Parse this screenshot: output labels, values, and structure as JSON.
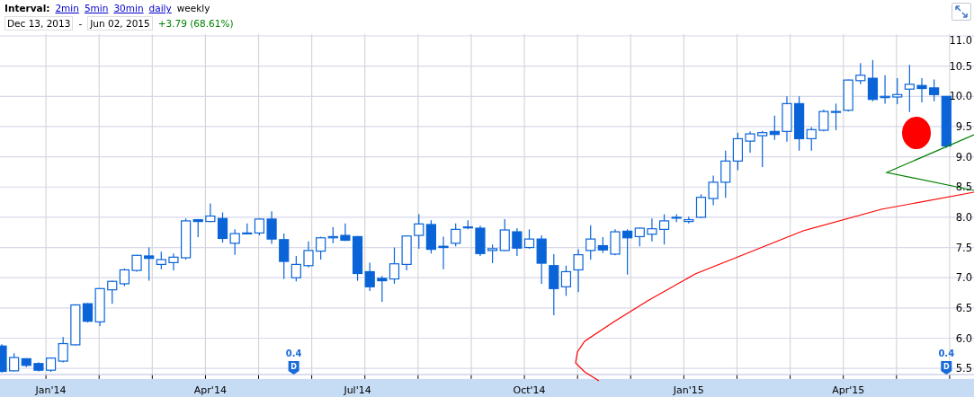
{
  "header": {
    "interval_label": "Interval:",
    "intervals": [
      {
        "label": "2min",
        "selected": false
      },
      {
        "label": "5min",
        "selected": false
      },
      {
        "label": "30min",
        "selected": false
      },
      {
        "label": "daily",
        "selected": false
      },
      {
        "label": "weekly",
        "selected": true
      }
    ],
    "start_date": "Dec 13, 2013",
    "separator": "-",
    "end_date": "Jun 02, 2015",
    "change": "+3.79 (68.61%)"
  },
  "chart": {
    "chart_data": {
      "type": "candlestick",
      "ylim": [
        5.4,
        11.0
      ],
      "grid": true,
      "categories": [
        null,
        null,
        null,
        null,
        "Jan'14",
        null,
        null,
        null,
        null,
        null,
        null,
        null,
        null,
        null,
        null,
        null,
        null,
        "Apr'14",
        null,
        null,
        null,
        null,
        null,
        null,
        null,
        null,
        null,
        null,
        null,
        "Jul'14",
        null,
        null,
        null,
        null,
        null,
        null,
        null,
        null,
        null,
        null,
        null,
        null,
        null,
        "Oct'14",
        null,
        null,
        null,
        null,
        null,
        null,
        null,
        null,
        null,
        null,
        null,
        null,
        "Jan'15",
        null,
        null,
        null,
        null,
        null,
        null,
        null,
        null,
        null,
        null,
        null,
        null,
        "Apr'15",
        null,
        null,
        null,
        null,
        null,
        null,
        null,
        null
      ],
      "yticks": [
        {
          "value": 5.5,
          "label": "5.5"
        },
        {
          "value": 6.0,
          "label": "6.0"
        },
        {
          "value": 6.5,
          "label": "6.5"
        },
        {
          "value": 7.0,
          "label": "7.0"
        },
        {
          "value": 7.5,
          "label": "7.5"
        },
        {
          "value": 8.0,
          "label": "8.0"
        },
        {
          "value": 8.5,
          "label": "8.5"
        },
        {
          "value": 9.0,
          "label": "9.0"
        },
        {
          "value": 9.5,
          "label": "9.5"
        },
        {
          "value": 10.0,
          "label": "10.0"
        },
        {
          "value": 10.5,
          "label": "10.5"
        },
        {
          "value": 11.0,
          "label": "11.0"
        }
      ],
      "ohlc": [
        [
          5.87,
          5.9,
          5.43,
          5.45
        ],
        [
          5.46,
          5.75,
          5.45,
          5.68
        ],
        [
          5.66,
          5.67,
          5.52,
          5.55
        ],
        [
          5.58,
          5.6,
          5.45,
          5.47
        ],
        [
          5.47,
          5.68,
          5.44,
          5.67
        ],
        [
          5.62,
          6.02,
          5.6,
          5.91
        ],
        [
          5.89,
          6.56,
          5.88,
          6.55
        ],
        [
          6.57,
          6.58,
          6.26,
          6.28
        ],
        [
          6.27,
          6.83,
          6.2,
          6.82
        ],
        [
          6.8,
          6.95,
          6.57,
          6.94
        ],
        [
          6.9,
          7.15,
          6.86,
          7.13
        ],
        [
          7.12,
          7.38,
          7.1,
          7.37
        ],
        [
          7.36,
          7.5,
          6.95,
          7.32
        ],
        [
          7.22,
          7.43,
          7.14,
          7.3
        ],
        [
          7.25,
          7.4,
          7.12,
          7.34
        ],
        [
          7.33,
          7.98,
          7.3,
          7.94
        ],
        [
          7.96,
          7.97,
          7.67,
          7.93
        ],
        [
          7.93,
          8.23,
          7.92,
          8.02
        ],
        [
          7.98,
          8.08,
          7.58,
          7.65
        ],
        [
          7.57,
          7.8,
          7.38,
          7.73
        ],
        [
          7.73,
          7.9,
          7.72,
          7.74
        ],
        [
          7.74,
          7.98,
          7.7,
          7.97
        ],
        [
          7.97,
          8.1,
          7.56,
          7.64
        ],
        [
          7.63,
          7.73,
          6.98,
          7.27
        ],
        [
          7.0,
          7.36,
          6.94,
          7.22
        ],
        [
          7.2,
          7.6,
          7.17,
          7.45
        ],
        [
          7.44,
          7.68,
          7.3,
          7.66
        ],
        [
          7.66,
          7.84,
          7.57,
          7.68
        ],
        [
          7.7,
          7.9,
          7.61,
          7.62
        ],
        [
          7.68,
          7.69,
          6.95,
          7.07
        ],
        [
          7.1,
          7.25,
          6.78,
          6.85
        ],
        [
          6.99,
          7.03,
          6.6,
          6.95
        ],
        [
          6.98,
          7.5,
          6.9,
          7.23
        ],
        [
          7.22,
          7.7,
          7.12,
          7.69
        ],
        [
          7.7,
          8.05,
          7.48,
          7.89
        ],
        [
          7.88,
          7.95,
          7.4,
          7.47
        ],
        [
          7.52,
          7.68,
          7.14,
          7.5
        ],
        [
          7.57,
          7.9,
          7.52,
          7.8
        ],
        [
          7.83,
          7.95,
          7.8,
          7.84
        ],
        [
          7.82,
          7.86,
          7.36,
          7.4
        ],
        [
          7.45,
          7.55,
          7.24,
          7.48
        ],
        [
          7.45,
          7.97,
          7.44,
          7.79
        ],
        [
          7.76,
          7.82,
          7.36,
          7.49
        ],
        [
          7.5,
          7.8,
          7.48,
          7.64
        ],
        [
          7.64,
          7.7,
          6.9,
          7.24
        ],
        [
          7.2,
          7.39,
          6.38,
          6.82
        ],
        [
          6.85,
          7.2,
          6.7,
          7.1
        ],
        [
          7.13,
          7.47,
          6.76,
          7.38
        ],
        [
          7.45,
          7.87,
          7.3,
          7.64
        ],
        [
          7.53,
          7.67,
          7.41,
          7.46
        ],
        [
          7.39,
          7.8,
          7.37,
          7.76
        ],
        [
          7.77,
          7.8,
          7.05,
          7.66
        ],
        [
          7.68,
          7.83,
          7.52,
          7.82
        ],
        [
          7.72,
          7.98,
          7.6,
          7.81
        ],
        [
          7.8,
          8.05,
          7.55,
          7.94
        ],
        [
          7.99,
          8.05,
          7.92,
          8.0
        ],
        [
          7.93,
          8.01,
          7.9,
          7.96
        ],
        [
          8.0,
          8.38,
          7.99,
          8.33
        ],
        [
          8.31,
          8.69,
          8.2,
          8.58
        ],
        [
          8.58,
          9.1,
          8.32,
          8.93
        ],
        [
          8.93,
          9.4,
          8.78,
          9.3
        ],
        [
          9.26,
          9.42,
          9.07,
          9.38
        ],
        [
          9.35,
          9.43,
          8.83,
          9.4
        ],
        [
          9.42,
          9.68,
          9.28,
          9.37
        ],
        [
          9.42,
          10.0,
          9.25,
          9.88
        ],
        [
          9.88,
          10.0,
          9.1,
          9.3
        ],
        [
          9.3,
          9.49,
          9.1,
          9.45
        ],
        [
          9.44,
          9.78,
          9.42,
          9.75
        ],
        [
          9.74,
          9.88,
          9.44,
          9.75
        ],
        [
          9.77,
          10.28,
          9.75,
          10.27
        ],
        [
          10.26,
          10.55,
          10.2,
          10.35
        ],
        [
          10.3,
          10.6,
          9.92,
          9.95
        ],
        [
          9.98,
          10.35,
          9.88,
          10.0
        ],
        [
          9.99,
          10.3,
          9.87,
          10.03
        ],
        [
          10.12,
          10.52,
          9.74,
          10.2
        ],
        [
          10.18,
          10.3,
          9.9,
          10.13
        ],
        [
          10.14,
          10.28,
          9.92,
          10.03
        ],
        [
          10.0,
          10.0,
          9.15,
          9.18
        ]
      ]
    },
    "dividends": [
      {
        "amount": "0.4",
        "letter": "D"
      },
      {
        "amount": "0.4",
        "letter": "D"
      }
    ]
  }
}
